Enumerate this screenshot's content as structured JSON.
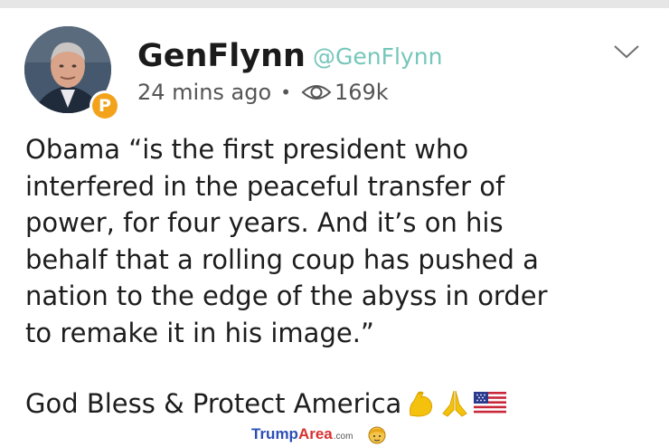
{
  "post": {
    "author_name": "GenFlynn",
    "author_handle": "@GenFlynn",
    "time_ago": "24 mins ago",
    "separator": "•",
    "views": "169k",
    "body_lines": [
      "Obama “is the first president who",
      "interfered in the peaceful transfer of",
      "power, for four years. And it’s on his",
      "behalf that a rolling coup has pushed a",
      "nation to the edge of the abyss in order",
      "to remake it in his image.”"
    ],
    "closing": "God Bless & Protect America"
  },
  "badge_letter": "P",
  "icons": [
    "avatar-image",
    "parler-badge-icon",
    "eye-icon",
    "chevron-down-icon",
    "flexed-biceps-icon",
    "folded-hands-icon",
    "us-flag-icon",
    "watermark-face-icon"
  ],
  "colors": {
    "handle": "#76c6bb",
    "badge": "#f2a31b",
    "text": "#1d1d1d",
    "watermark_blue": "#2c4fb6",
    "watermark_red": "#d93030"
  },
  "watermark": {
    "part1": "Trump",
    "part2": "Area",
    "part3": ".com"
  }
}
